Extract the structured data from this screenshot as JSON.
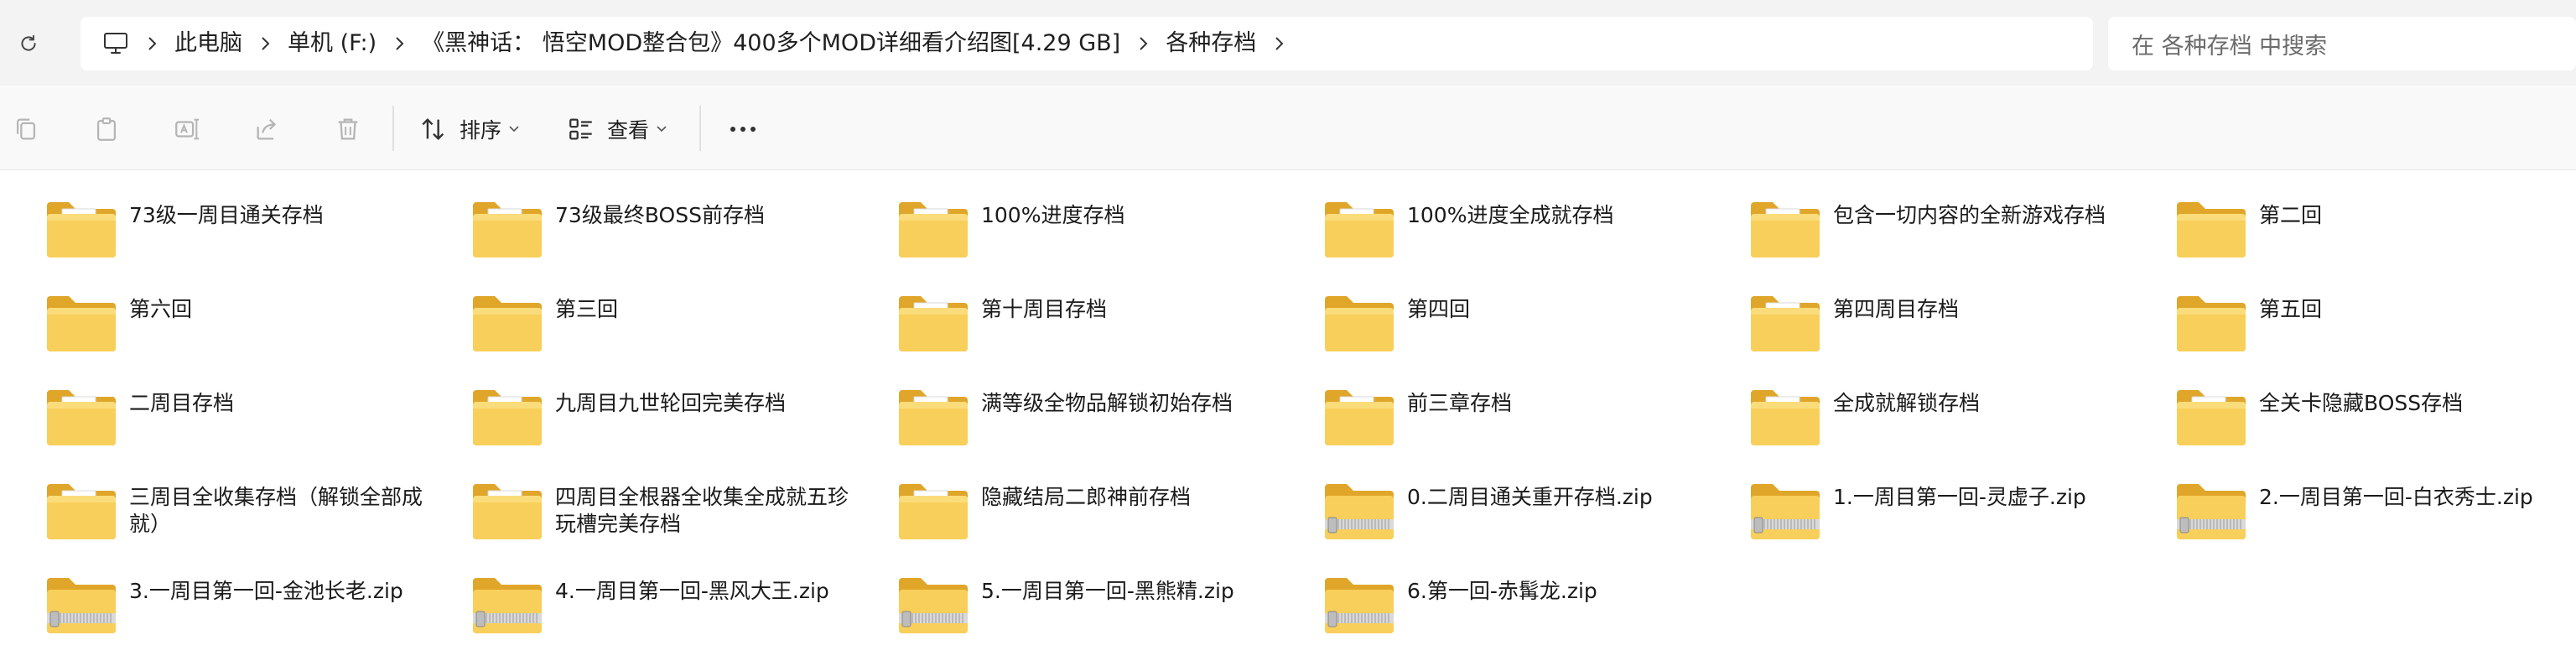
{
  "breadcrumb": [
    "此电脑",
    "单机 (F:)",
    "《黑神话： 悟空MOD整合包》400多个MOD详细看介绍图[4.29 GB]",
    "各种存档"
  ],
  "search": {
    "placeholder": "在 各种存档 中搜索"
  },
  "toolbar": {
    "sort_label": "排序",
    "view_label": "查看"
  },
  "icons": {
    "refresh": "refresh-icon",
    "computer": "computer-icon",
    "separator": "chevron-right-icon",
    "copy": "copy-icon",
    "paste": "paste-icon",
    "rename": "rename-icon",
    "share": "share-icon",
    "delete": "delete-icon",
    "sort": "sort-icon",
    "view": "view-icon",
    "more": "more-icon",
    "folder": "folder-icon",
    "zip": "zip-folder-icon"
  },
  "colors": {
    "folder": "#f4c542",
    "folder_back": "#e2a82a",
    "accent": "#0067c0"
  },
  "files": [
    {
      "name": "73级一周目通关存档",
      "type": "folder-doc"
    },
    {
      "name": "73级最终BOSS前存档",
      "type": "folder-doc"
    },
    {
      "name": "100%进度存档",
      "type": "folder-doc"
    },
    {
      "name": "100%进度全成就存档",
      "type": "folder-doc"
    },
    {
      "name": "包含一切内容的全新游戏存档",
      "type": "folder-doc"
    },
    {
      "name": "第二回",
      "type": "folder"
    },
    {
      "name": "第六回",
      "type": "folder"
    },
    {
      "name": "第三回",
      "type": "folder"
    },
    {
      "name": "第十周目存档",
      "type": "folder-doc"
    },
    {
      "name": "第四回",
      "type": "folder"
    },
    {
      "name": "第四周目存档",
      "type": "folder-doc"
    },
    {
      "name": "第五回",
      "type": "folder"
    },
    {
      "name": "二周目存档",
      "type": "folder-doc"
    },
    {
      "name": "九周目九世轮回完美存档",
      "type": "folder-doc"
    },
    {
      "name": "满等级全物品解锁初始存档",
      "type": "folder-doc"
    },
    {
      "name": "前三章存档",
      "type": "folder-doc"
    },
    {
      "name": "全成就解锁存档",
      "type": "folder-doc"
    },
    {
      "name": "全关卡隐藏BOSS存档",
      "type": "folder-doc"
    },
    {
      "name": "三周目全收集存档（解锁全部成就）",
      "type": "folder-doc"
    },
    {
      "name": "四周目全根器全收集全成就五珍玩槽完美存档",
      "type": "folder-doc"
    },
    {
      "name": "隐藏结局二郎神前存档",
      "type": "folder-doc"
    },
    {
      "name": "0.二周目通关重开存档.zip",
      "type": "zip"
    },
    {
      "name": "1.一周目第一回-灵虚子.zip",
      "type": "zip"
    },
    {
      "name": "2.一周目第一回-白衣秀士.zip",
      "type": "zip"
    },
    {
      "name": "3.一周目第一回-金池长老.zip",
      "type": "zip"
    },
    {
      "name": "4.一周目第一回-黑风大王.zip",
      "type": "zip"
    },
    {
      "name": "5.一周目第一回-黑熊精.zip",
      "type": "zip"
    },
    {
      "name": "6.第一回-赤髯龙.zip",
      "type": "zip"
    }
  ]
}
